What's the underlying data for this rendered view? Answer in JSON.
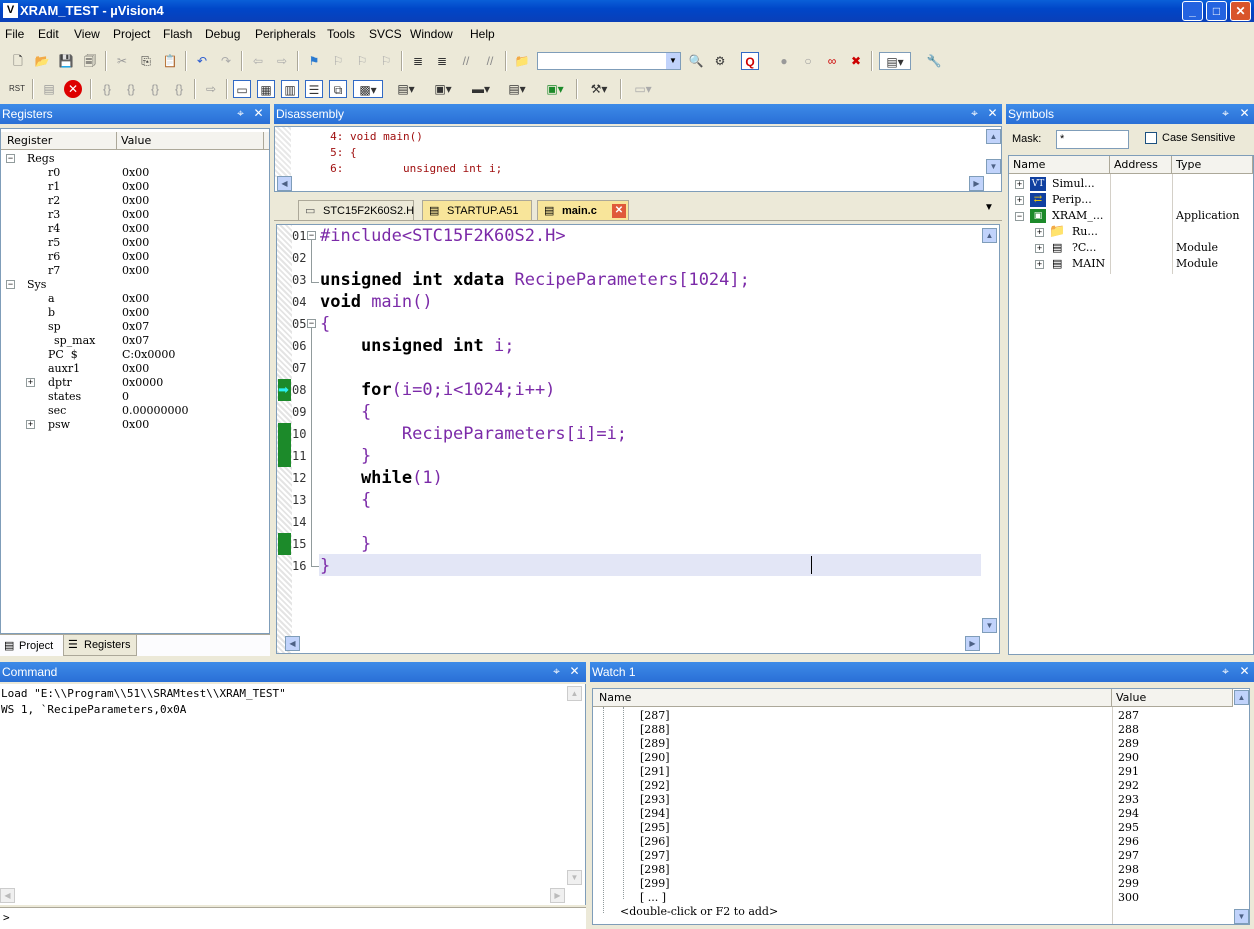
{
  "window": {
    "title": "XRAM_TEST  - µVision4",
    "min": "_",
    "max": "□",
    "close": "✕"
  },
  "menu": [
    "File",
    "Edit",
    "View",
    "Project",
    "Flash",
    "Debug",
    "Peripherals",
    "Tools",
    "SVCS",
    "Window",
    "Help"
  ],
  "registers": {
    "title": "Registers",
    "col_register": "Register",
    "col_value": "Value",
    "groups": [
      {
        "name": "Regs",
        "items": [
          [
            "r0",
            "0x00"
          ],
          [
            "r1",
            "0x00"
          ],
          [
            "r2",
            "0x00"
          ],
          [
            "r3",
            "0x00"
          ],
          [
            "r4",
            "0x00"
          ],
          [
            "r5",
            "0x00"
          ],
          [
            "r6",
            "0x00"
          ],
          [
            "r7",
            "0x00"
          ]
        ]
      },
      {
        "name": "Sys",
        "items": [
          [
            "a",
            "0x00"
          ],
          [
            "b",
            "0x00"
          ],
          [
            "sp",
            "0x07"
          ],
          [
            "sp_max",
            "0x07"
          ],
          [
            "PC  $",
            "C:0x0000"
          ],
          [
            "auxr1",
            "0x00"
          ],
          [
            "dptr",
            "0x0000"
          ],
          [
            "states",
            "0"
          ],
          [
            "sec",
            "0.00000000"
          ],
          [
            "psw",
            "0x00"
          ]
        ]
      }
    ],
    "tab_project": "Project",
    "tab_registers": "Registers"
  },
  "disassembly": {
    "title": "Disassembly",
    "lines": [
      "     4: void main()",
      "     5: {",
      "     6:         unsigned int i;"
    ]
  },
  "editor": {
    "tabs": [
      "STC15F2K60S2.H",
      "STARTUP.A51",
      "main.c"
    ],
    "line_numbers": [
      "01",
      "02",
      "03",
      "04",
      "05",
      "06",
      "07",
      "08",
      "09",
      "10",
      "11",
      "12",
      "13",
      "14",
      "15",
      "16"
    ],
    "lines": {
      "l01": "#include<STC15F2K60S2.H>",
      "l03a": "unsigned int xdata ",
      "l03b": "RecipeParameters[1024];",
      "l04a": "void ",
      "l04b": "main()",
      "l05": "{",
      "l06a": "    unsigned int ",
      "l06b": "i;",
      "l08a": "    for",
      "l08b": "(i=0;i<1024;i++)",
      "l09": "    {",
      "l10": "        RecipeParameters[i]=i;",
      "l11": "    }",
      "l12a": "    while",
      "l12b": "(1)",
      "l13": "    {",
      "l15": "    }",
      "l16": "}"
    }
  },
  "symbols": {
    "title": "Symbols",
    "mask_label": "Mask:",
    "mask_value": "*",
    "case_label": "Case Sensitive",
    "col_name": "Name",
    "col_address": "Address",
    "col_type": "Type",
    "rows": [
      {
        "name": "Simul...",
        "type": ""
      },
      {
        "name": "Perip...",
        "type": ""
      },
      {
        "name": "XRAM_...",
        "type": "Application"
      },
      {
        "name": "Ru...",
        "type": ""
      },
      {
        "name": "?C...",
        "type": "Module"
      },
      {
        "name": "MAIN",
        "type": "Module"
      }
    ]
  },
  "command": {
    "title": "Command",
    "lines": [
      "Load \"E:\\\\Program\\\\51\\\\SRAMtest\\\\XRAM_TEST\"",
      "WS 1, `RecipeParameters,0x0A"
    ],
    "prompt": ">"
  },
  "watch": {
    "title": "Watch 1",
    "col_name": "Name",
    "col_value": "Value",
    "rows": [
      [
        "[287]",
        "287"
      ],
      [
        "[288]",
        "288"
      ],
      [
        "[289]",
        "289"
      ],
      [
        "[290]",
        "290"
      ],
      [
        "[291]",
        "291"
      ],
      [
        "[292]",
        "292"
      ],
      [
        "[293]",
        "293"
      ],
      [
        "[294]",
        "294"
      ],
      [
        "[295]",
        "295"
      ],
      [
        "[296]",
        "296"
      ],
      [
        "[297]",
        "297"
      ],
      [
        "[298]",
        "298"
      ],
      [
        "[299]",
        "299"
      ],
      [
        "[ ... ]",
        "300"
      ]
    ],
    "add_hint": "<double-click or F2 to add>"
  }
}
